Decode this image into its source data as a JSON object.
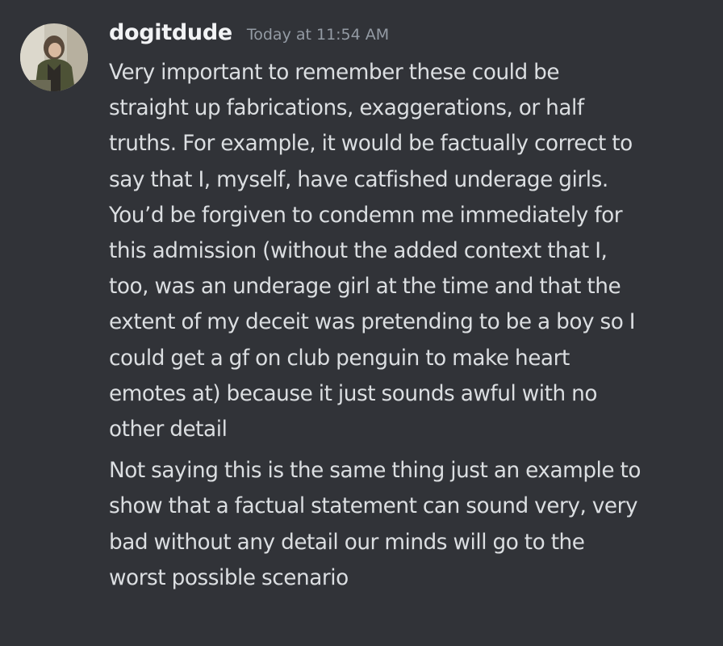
{
  "message": {
    "author": "dogitdude",
    "timestamp": "Today at 11:54 AM",
    "avatar_icon": "user-avatar-photo",
    "paragraphs": [
      {
        "lines": [
          "Very important to remember these could be",
          "straight up fabrications, exaggerations, or half",
          "truths. For example, it would be factually correct to",
          "say that I, myself, have catfished underage girls.",
          "You’d be forgiven to condemn me immediately for",
          "this admission (without the added context that I,",
          "too, was an underage girl at the time and that the",
          "extent of my deceit was pretending to be a boy so I",
          "could get a gf on club penguin to make heart",
          "emotes at) because it just sounds awful with no",
          "other detail"
        ]
      },
      {
        "lines": [
          "Not saying this is the same thing just an example to",
          "show that a factual statement can sound very, very",
          "bad without any detail our minds will go to the",
          "worst possible scenario"
        ]
      }
    ]
  },
  "colors": {
    "background": "#313338",
    "text": "#dbdee1",
    "username": "#f2f3f5",
    "timestamp": "#949ba4"
  }
}
